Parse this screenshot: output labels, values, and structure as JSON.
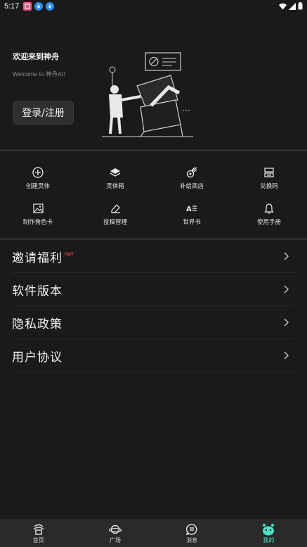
{
  "status_bar": {
    "time": "5:17",
    "icons": [
      "app-notification-icon",
      "download-icon",
      "download-icon",
      "wifi-icon",
      "signal-icon",
      "battery-icon"
    ]
  },
  "header": {
    "welcome_title": "欢迎来到神舟",
    "welcome_subtitle": "Welcome to 神舟AI!",
    "login_button": "登录/注册"
  },
  "grid": [
    {
      "label": "创建灵体",
      "icon": "plus-circle-icon"
    },
    {
      "label": "灵体箱",
      "icon": "box-icon"
    },
    {
      "label": "补给商店",
      "icon": "meteor-icon"
    },
    {
      "label": "兑换码",
      "icon": "redeem-icon"
    },
    {
      "label": "制作角色卡",
      "icon": "image-icon"
    },
    {
      "label": "投稿管理",
      "icon": "edit-icon"
    },
    {
      "label": "世界书",
      "icon": "worldbook-icon"
    },
    {
      "label": "使用手册",
      "icon": "bell-icon"
    }
  ],
  "list": [
    {
      "label": "邀请福利",
      "badge": "HOT"
    },
    {
      "label": "软件版本",
      "badge": ""
    },
    {
      "label": "隐私政策",
      "badge": ""
    },
    {
      "label": "用户协议",
      "badge": ""
    }
  ],
  "bottom_nav": [
    {
      "label": "首页",
      "icon": "home-icon",
      "active": false
    },
    {
      "label": "广场",
      "icon": "planet-icon",
      "active": false
    },
    {
      "label": "消息",
      "icon": "message-icon",
      "active": false
    },
    {
      "label": "我的",
      "icon": "profile-icon",
      "active": true
    }
  ],
  "colors": {
    "background": "#1a1a1a",
    "accent": "#4fe0c8",
    "hot": "#e8452c",
    "nav_bg": "#2a2a2a"
  }
}
